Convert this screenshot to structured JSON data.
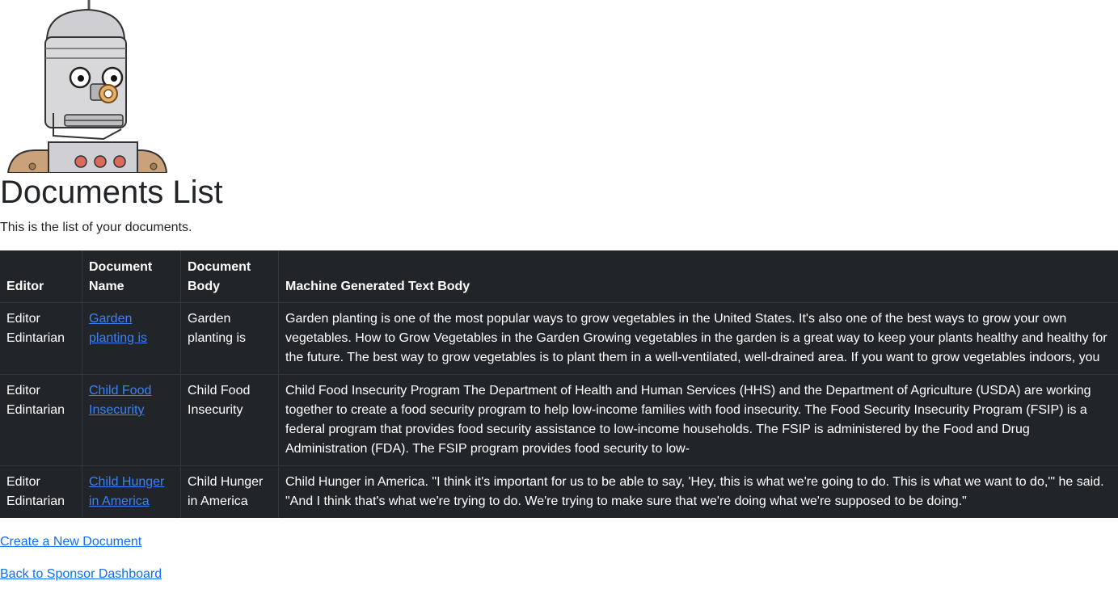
{
  "page": {
    "title": "Documents List",
    "subtitle": "This is the list of your documents."
  },
  "logo": {
    "icon": "robot-mascot-icon"
  },
  "table": {
    "headers": {
      "editor": "Editor",
      "document_name": "Document Name",
      "document_body": "Document Body",
      "machine_text": "Machine Generated Text Body"
    },
    "rows": [
      {
        "editor": "Editor Edintarian",
        "document_name": "Garden planting is",
        "document_body": "Garden planting is",
        "machine_text": "Garden planting is one of the most popular ways to grow vegetables in the United States. It's also one of the best ways to grow your own vegetables. How to Grow Vegetables in the Garden Growing vegetables in the garden is a great way to keep your plants healthy and healthy for the future. The best way to grow vegetables is to plant them in a well-ventilated, well-drained area. If you want to grow vegetables indoors, you"
      },
      {
        "editor": "Editor Edintarian",
        "document_name": "Child Food Insecurity",
        "document_body": "Child Food Insecurity",
        "machine_text": "Child Food Insecurity Program The Department of Health and Human Services (HHS) and the Department of Agriculture (USDA) are working together to create a food security program to help low-income families with food insecurity. The Food Security Insecurity Program (FSIP) is a federal program that provides food security assistance to low-income households. The FSIP is administered by the Food and Drug Administration (FDA). The FSIP program provides food security to low-"
      },
      {
        "editor": "Editor Edintarian",
        "document_name": "Child Hunger in America",
        "document_body": "Child Hunger in America",
        "machine_text": "Child Hunger in America. \"I think it's important for us to be able to say, 'Hey, this is what we're going to do. This is what we want to do,'\" he said. \"And I think that's what we're trying to do. We're trying to make sure that we're doing what we're supposed to be doing.\""
      }
    ]
  },
  "links": {
    "create": "Create a New Document",
    "back": "Back to Sponsor Dashboard"
  },
  "colors": {
    "table_bg": "#212529",
    "link": "#0d6efd"
  }
}
